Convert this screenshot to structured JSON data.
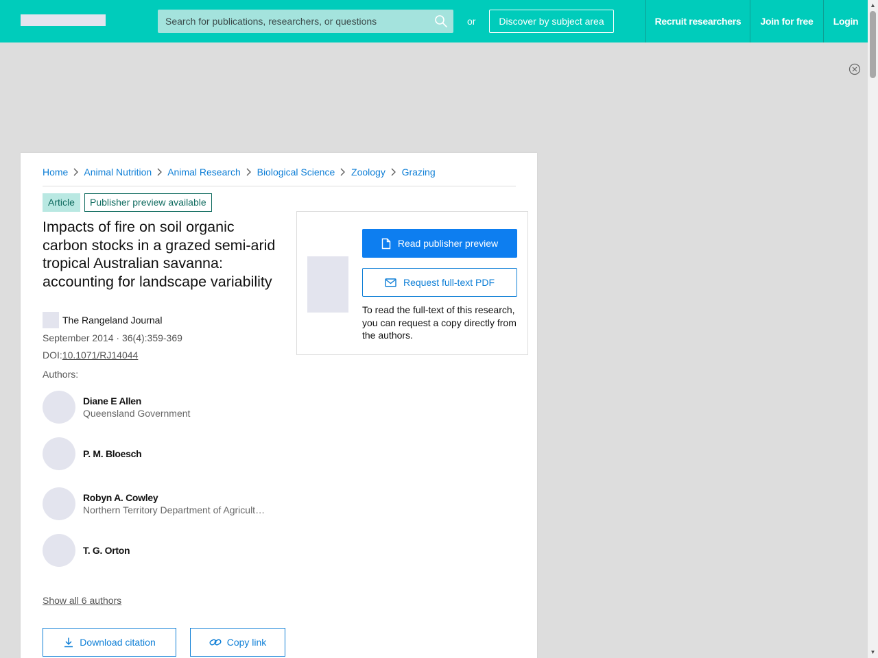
{
  "header": {
    "search_placeholder": "Search for publications, researchers, or questions",
    "or_text": "or",
    "discover_label": "Discover by subject area",
    "nav": {
      "recruit": "Recruit researchers",
      "join": "Join for free",
      "login": "Login"
    }
  },
  "breadcrumb": [
    "Home",
    "Animal Nutrition",
    "Animal Research",
    "Biological Science",
    "Zoology",
    "Grazing"
  ],
  "article": {
    "type_tag": "Article",
    "preview_tag": "Publisher preview available",
    "title": "Impacts of fire on soil organic carbon stocks in a grazed semi-arid tropical Australian savanna: accounting for landscape variability",
    "journal": "The Rangeland Journal",
    "date": "September 2014 · 36(4):359-369",
    "doi_label": "DOI:",
    "doi": "10.1071/RJ14044",
    "authors_label": "Authors:",
    "authors": [
      {
        "name": "Diane E Allen",
        "institution": "Queensland Government"
      },
      {
        "name": "P. M. Bloesch",
        "institution": ""
      },
      {
        "name": "Robyn A. Cowley",
        "institution": "Northern Territory Department of Agricult…"
      },
      {
        "name": "T. G. Orton",
        "institution": ""
      }
    ],
    "show_all": "Show all 6 authors",
    "download_citation": "Download citation",
    "copy_link": "Copy link"
  },
  "preview_panel": {
    "read_label": "Read publisher preview",
    "request_label": "Request full-text PDF",
    "note": "To read the full-text of this research, you can request a copy directly from the authors."
  },
  "colors": {
    "brand": "#00ccbb",
    "link": "#0d7ed6",
    "primary_button": "#0d7ef0",
    "tag_bg": "#b9e8e2",
    "tag_text": "#0f6b5f",
    "placeholder": "#e3e4ee"
  },
  "icons": {
    "search": "search-icon",
    "close": "close-circle-icon",
    "breadcrumb_separator": "chevron-right-icon",
    "read": "document-icon",
    "request": "envelope-icon",
    "download": "download-icon",
    "copy": "link-icon"
  }
}
